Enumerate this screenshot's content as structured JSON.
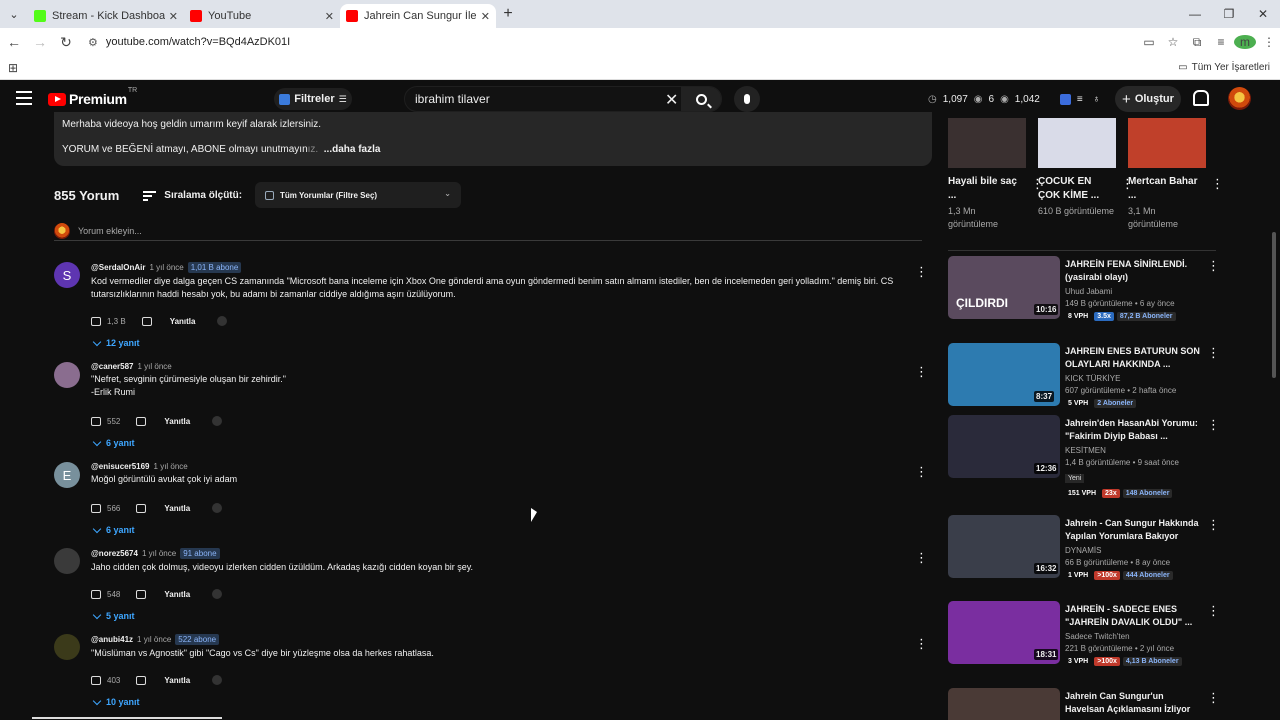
{
  "browser": {
    "tabs": [
      {
        "title": "Stream - Kick Dashboard",
        "favicon_color": "#53fc18"
      },
      {
        "title": "YouTube",
        "favicon_color": "#ff0000"
      },
      {
        "title": "Jahrein Can Sungur İle Geçmişi",
        "favicon_color": "#ff0000"
      }
    ],
    "url": "youtube.com/watch?v=BQd4AzDK01I",
    "bookmarks_all": "Tüm Yer İşaretleri",
    "profile_initial": "m"
  },
  "header": {
    "logo_word": "Premium",
    "country": "TR",
    "filters_label": "Filtreler",
    "search_value": "ibrahim tilaver",
    "stats": [
      "1,097",
      "6",
      "1,042"
    ],
    "create_label": "Oluştur"
  },
  "description": {
    "line1": "Merhaba videoya hoş geldin umarım keyif alarak izlersiniz.",
    "line2": "YORUM ve BEĞENİ atmayı, ABONE olmayı unutmayın",
    "line2_fade": "ız.",
    "more": "...daha fazla"
  },
  "comments_header": {
    "count": "855 Yorum",
    "sort_label": "Sıralama ölçütü:",
    "filter_select": "Tüm Yorumlar (Filtre Seç)",
    "add_placeholder": "Yorum ekleyin..."
  },
  "comments": [
    {
      "avatar_letter": "S",
      "avatar_color": "#5e35b1",
      "author": "@SerdalOnAir",
      "time": "1 yıl önce",
      "badge": "1,01 B abone",
      "lines": [
        "Kod vermediler diye dalga geçen CS zamanında \"Microsoft bana inceleme için Xbox One gönderdi ama oyun göndermedi benim satın almamı istediler, ben de incelemeden geri yolladım.\" demiş biri. CS",
        "tutarsızlıklarının haddi hesabı yok, bu adamı bi zamanlar ciddiye aldığıma aşırı üzülüyorum."
      ],
      "likes": "1,3 B",
      "reply_label": "Yanıtla",
      "replies": "12 yanıt"
    },
    {
      "avatar_letter": "",
      "avatar_color": "#8a6d8f",
      "author": "@caner587",
      "time": "1 yıl önce",
      "badge": "",
      "lines": [
        "\"Nefret, sevginin çürümesiyle oluşan bir zehirdir.\"",
        "-Erlik Rumi"
      ],
      "likes": "552",
      "reply_label": "Yanıtla",
      "replies": "6 yanıt"
    },
    {
      "avatar_letter": "E",
      "avatar_color": "#78909c",
      "author": "@enisucer5169",
      "time": "1 yıl önce",
      "badge": "",
      "lines": [
        "Moğol görüntülü avukat çok iyi adam"
      ],
      "likes": "566",
      "reply_label": "Yanıtla",
      "replies": "6 yanıt"
    },
    {
      "avatar_letter": "",
      "avatar_color": "#3a3a3a",
      "author": "@norez5674",
      "time": "1 yıl önce",
      "badge": "91 abone",
      "lines": [
        "Jaho cidden çok dolmuş, videoyu izlerken cidden üzüldüm. Arkadaş kazığı cidden koyan bir şey."
      ],
      "likes": "548",
      "reply_label": "Yanıtla",
      "replies": "5 yanıt"
    },
    {
      "avatar_letter": "",
      "avatar_color": "#3b3a1a",
      "author": "@anubi41z",
      "time": "1 yıl önce",
      "badge": "522 abone",
      "lines": [
        "\"Müslüman vs Agnostik\" gibi \"Cago vs Cs\" diye bir yüzleşme olsa da herkes rahatlasa."
      ],
      "likes": "403",
      "reply_label": "Yanıtla",
      "replies": "10 yanıt"
    }
  ],
  "shorts": [
    {
      "title": "Hayali bile saç ...",
      "views": "1,3 Mn görüntüleme",
      "color": "#3a3030"
    },
    {
      "title": "ÇOCUK EN ÇOK KİME ...",
      "views": "610 B görüntüleme",
      "color": "#d9dbe8"
    },
    {
      "title": "Mertcan Bahar ...",
      "views": "3,1 Mn görüntüleme",
      "color": "#c0402a"
    }
  ],
  "videos": [
    {
      "title": "JAHREİN FENA SİNİRLENDİ. (yasirabi olayı)",
      "channel": "Uhud Jabami",
      "views": "149 B görüntüleme • 6 ay önce",
      "duration": "10:16",
      "vph": "8 VPH",
      "mult": "3.5x",
      "mult_red": false,
      "subs": "87,2 B Aboneler",
      "yeni": "",
      "thumb_color": "#5a4a5e",
      "thumb_text": "ÇILDIRDI"
    },
    {
      "title": "JAHREIN ENES BATURUN SON OLAYLARI HAKKINDA ...",
      "channel": "KICK TÜRKİYE",
      "views": "607 görüntüleme • 2 hafta önce",
      "duration": "8:37",
      "vph": "5 VPH",
      "mult": "",
      "mult_red": false,
      "subs": "2 Aboneler",
      "yeni": "",
      "thumb_color": "#2d7bb0",
      "thumb_text": ""
    },
    {
      "title": "Jahrein'den HasanAbi Yorumu: \"Fakirim Diyip Babası ...",
      "channel": "KESİTMEN",
      "views": "1,4 B görüntüleme • 9 saat önce",
      "duration": "12:36",
      "vph": "151 VPH",
      "mult": "23x",
      "mult_red": true,
      "subs": "148 Aboneler",
      "yeni": "Yeni",
      "thumb_color": "#2a2a3a",
      "thumb_text": ""
    },
    {
      "title": "Jahrein - Can Sungur Hakkında Yapılan Yorumlara Bakıyor",
      "channel": "DYNAMİS",
      "views": "66 B görüntüleme • 8 ay önce",
      "duration": "16:32",
      "vph": "1 VPH",
      "mult": ">100x",
      "mult_red": true,
      "subs": "444 Aboneler",
      "yeni": "",
      "thumb_color": "#3a3e4a",
      "thumb_text": ""
    },
    {
      "title": "JAHREİN - SADECE ENES \"JAHREİN DAVALIK OLDU\" ...",
      "channel": "Sadece Twitch'ten",
      "views": "221 B görüntüleme • 2 yıl önce",
      "duration": "18:31",
      "vph": "3 VPH",
      "mult": ">100x",
      "mult_red": true,
      "subs": "4,13 B Aboneler",
      "yeni": "",
      "thumb_color": "#7a2ea0",
      "thumb_text": ""
    },
    {
      "title": "Jahrein Can Sungur'un Havelsan Açıklamasını İzliyor",
      "channel": "",
      "views": "",
      "duration": "",
      "vph": "",
      "mult": "",
      "mult_red": false,
      "subs": "",
      "yeni": "",
      "thumb_color": "#4a3a36",
      "thumb_text": ""
    }
  ]
}
